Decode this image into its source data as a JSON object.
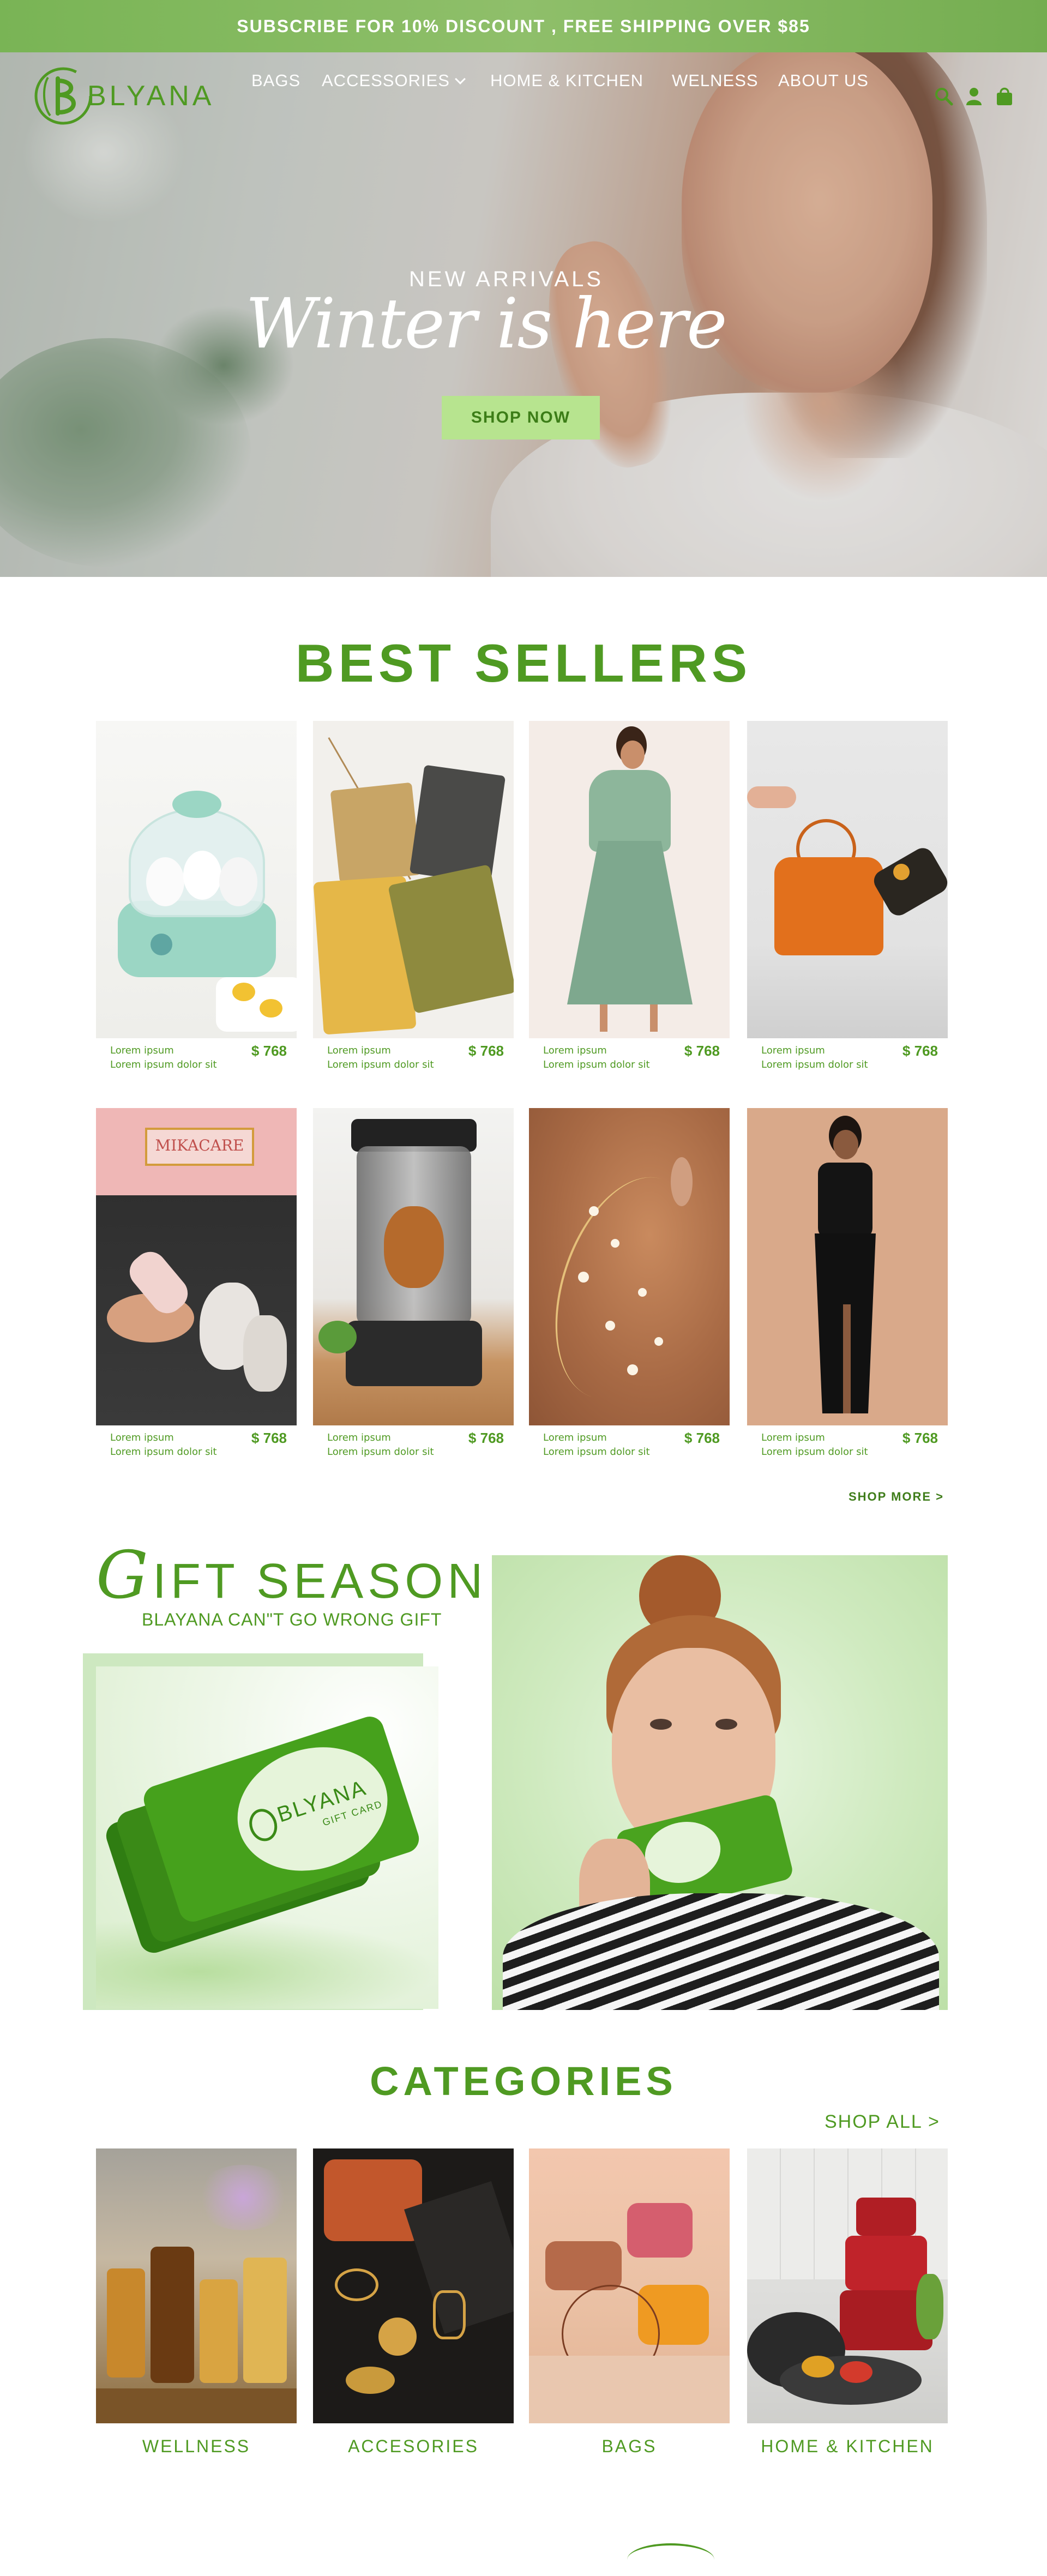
{
  "announcement": "SUBSCRIBE FOR 10% DISCOUNT , FREE SHIPPING OVER $85",
  "brand": {
    "name": "BLYANA",
    "accent_color": "#4f9a22",
    "light_accent": "#b7e48f"
  },
  "nav": {
    "items": [
      {
        "label": "BAGS",
        "has_dropdown": false
      },
      {
        "label": "ACCESSORIES",
        "has_dropdown": true
      },
      {
        "label": "HOME & KITCHEN",
        "has_dropdown": false
      },
      {
        "label": "WELNESS",
        "has_dropdown": false
      },
      {
        "label": "ABOUT US",
        "has_dropdown": false
      }
    ],
    "icons": [
      "search-icon",
      "account-icon",
      "cart-icon"
    ]
  },
  "hero": {
    "eyebrow": "NEW ARRIVALS",
    "headline": "Winter is here",
    "cta": "SHOP NOW"
  },
  "best_sellers": {
    "title": "BEST SELLERS",
    "products": [
      {
        "name": "Lorem ipsum",
        "desc": "Lorem ipsum dolor sit",
        "price": "$ 768",
        "image": "egg-cooker"
      },
      {
        "name": "Lorem ipsum",
        "desc": "Lorem ipsum dolor sit",
        "price": "$ 768",
        "image": "crossbody-bags"
      },
      {
        "name": "Lorem ipsum",
        "desc": "Lorem ipsum dolor sit",
        "price": "$ 768",
        "image": "green-floral-dress"
      },
      {
        "name": "Lorem ipsum",
        "desc": "Lorem ipsum dolor sit",
        "price": "$ 768",
        "image": "orange-handbag"
      },
      {
        "name": "Lorem ipsum",
        "desc": "Lorem ipsum dolor sit",
        "price": "$ 768",
        "image": "face-roller"
      },
      {
        "name": "Lorem ipsum",
        "desc": "Lorem ipsum dolor sit",
        "price": "$ 768",
        "image": "rotisserie-oven"
      },
      {
        "name": "Lorem ipsum",
        "desc": "Lorem ipsum dolor sit",
        "price": "$ 768",
        "image": "pearl-hair-vine"
      },
      {
        "name": "Lorem ipsum",
        "desc": "Lorem ipsum dolor sit",
        "price": "$ 768",
        "image": "black-gown"
      }
    ],
    "more_link": "SHOP MORE >"
  },
  "gift": {
    "title_initial": "G",
    "title_rest": "IFT SEASON",
    "subtitle": "BLAYANA CAN\"T GO WRONG GIFT",
    "card_brand": "BLYANA",
    "card_label": "GIFT CARD"
  },
  "categories": {
    "title": "CATEGORIES",
    "shop_all": "SHOP ALL >",
    "items": [
      {
        "label": "WELLNESS",
        "image": "essential-oils"
      },
      {
        "label": "ACCESORIES",
        "image": "jewelry"
      },
      {
        "label": "BAGS",
        "image": "handbags"
      },
      {
        "label": "HOME & KITCHEN",
        "image": "cookware"
      }
    ]
  }
}
